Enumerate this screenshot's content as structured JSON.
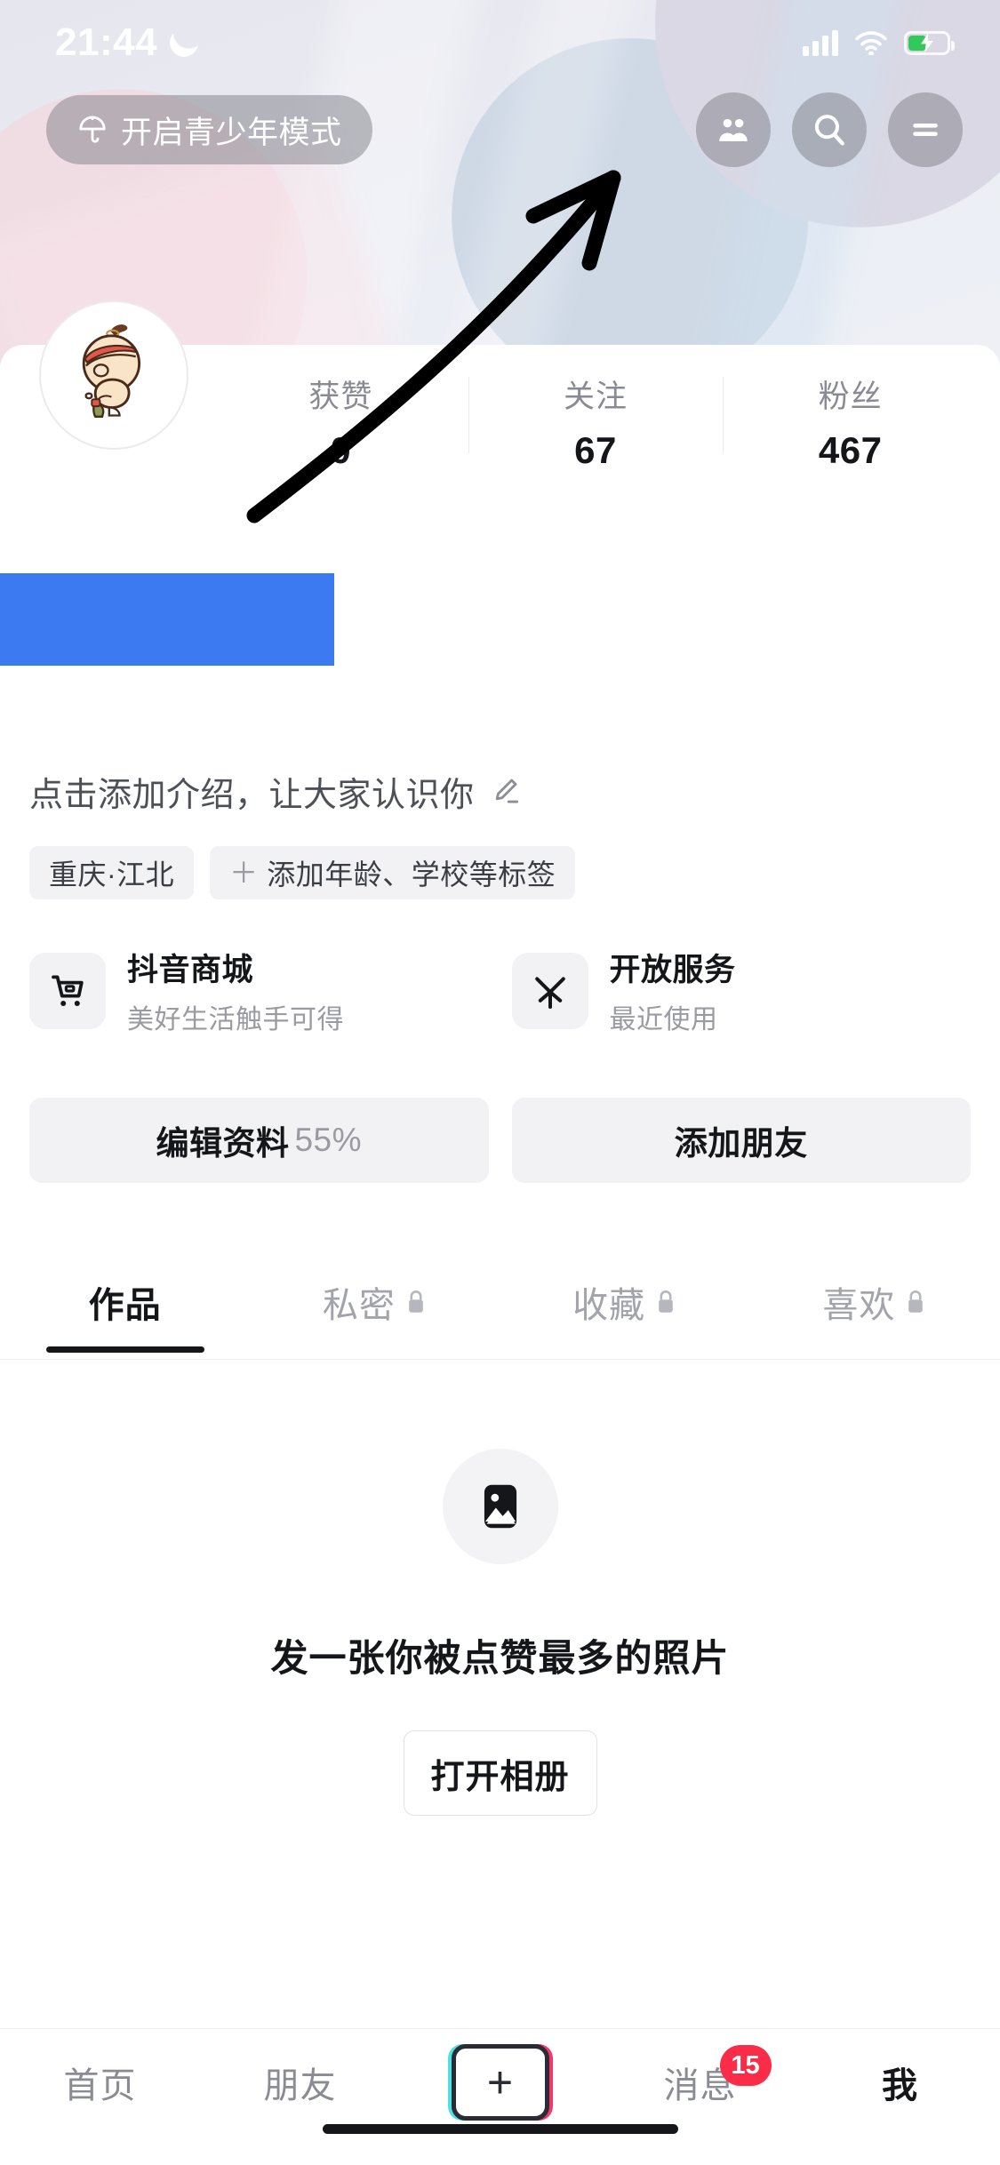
{
  "status_bar": {
    "time": "21:44",
    "dnd_icon": "moon-icon",
    "signal_icon": "cellular-signal-icon",
    "wifi_icon": "wifi-icon",
    "battery_icon": "battery-charging-icon"
  },
  "header": {
    "teen_mode_label": "开启青少年模式",
    "teen_mode_icon": "umbrella-icon",
    "friends_icon": "friends-icon",
    "search_icon": "search-icon",
    "menu_icon": "hamburger-menu-icon"
  },
  "profile": {
    "avatar_icon": "cartoon-avatar",
    "stats": [
      {
        "label": "获赞",
        "value": "0"
      },
      {
        "label": "关注",
        "value": "67"
      },
      {
        "label": "粉丝",
        "value": "467"
      }
    ],
    "redaction_color": "#3b7af0",
    "bio_placeholder": "点击添加介绍，让大家认识你",
    "bio_edit_icon": "pencil-edit-icon",
    "tags": [
      {
        "label": "重庆·江北",
        "has_plus": false
      },
      {
        "label": "添加年龄、学校等标签",
        "has_plus": true,
        "plus": "＋"
      }
    ]
  },
  "service_cards": [
    {
      "icon": "shopping-cart-icon",
      "title": "抖音商城",
      "subtitle": "美好生活触手可得"
    },
    {
      "icon": "open-service-icon",
      "title": "开放服务",
      "subtitle": "最近使用"
    }
  ],
  "actions": {
    "edit_profile_label": "编辑资料",
    "edit_profile_percent": "55%",
    "add_friend_label": "添加朋友"
  },
  "tabs": [
    {
      "label": "作品",
      "locked": false,
      "active": true
    },
    {
      "label": "私密",
      "locked": true,
      "active": false
    },
    {
      "label": "收藏",
      "locked": true,
      "active": false
    },
    {
      "label": "喜欢",
      "locked": true,
      "active": false
    }
  ],
  "empty_state": {
    "icon": "image-placeholder-icon",
    "title": "发一张你被点赞最多的照片",
    "button_label": "打开相册"
  },
  "bottom_nav": {
    "items": [
      {
        "label": "首页",
        "active": false
      },
      {
        "label": "朋友",
        "active": false
      },
      {
        "label": "",
        "active": false,
        "type": "create",
        "plus": "+"
      },
      {
        "label": "消息",
        "active": false,
        "badge": "15"
      },
      {
        "label": "我",
        "active": true
      }
    ]
  },
  "annotation": {
    "type": "hand-drawn-arrow",
    "points_to": "hamburger-menu-icon",
    "color": "#000000"
  }
}
